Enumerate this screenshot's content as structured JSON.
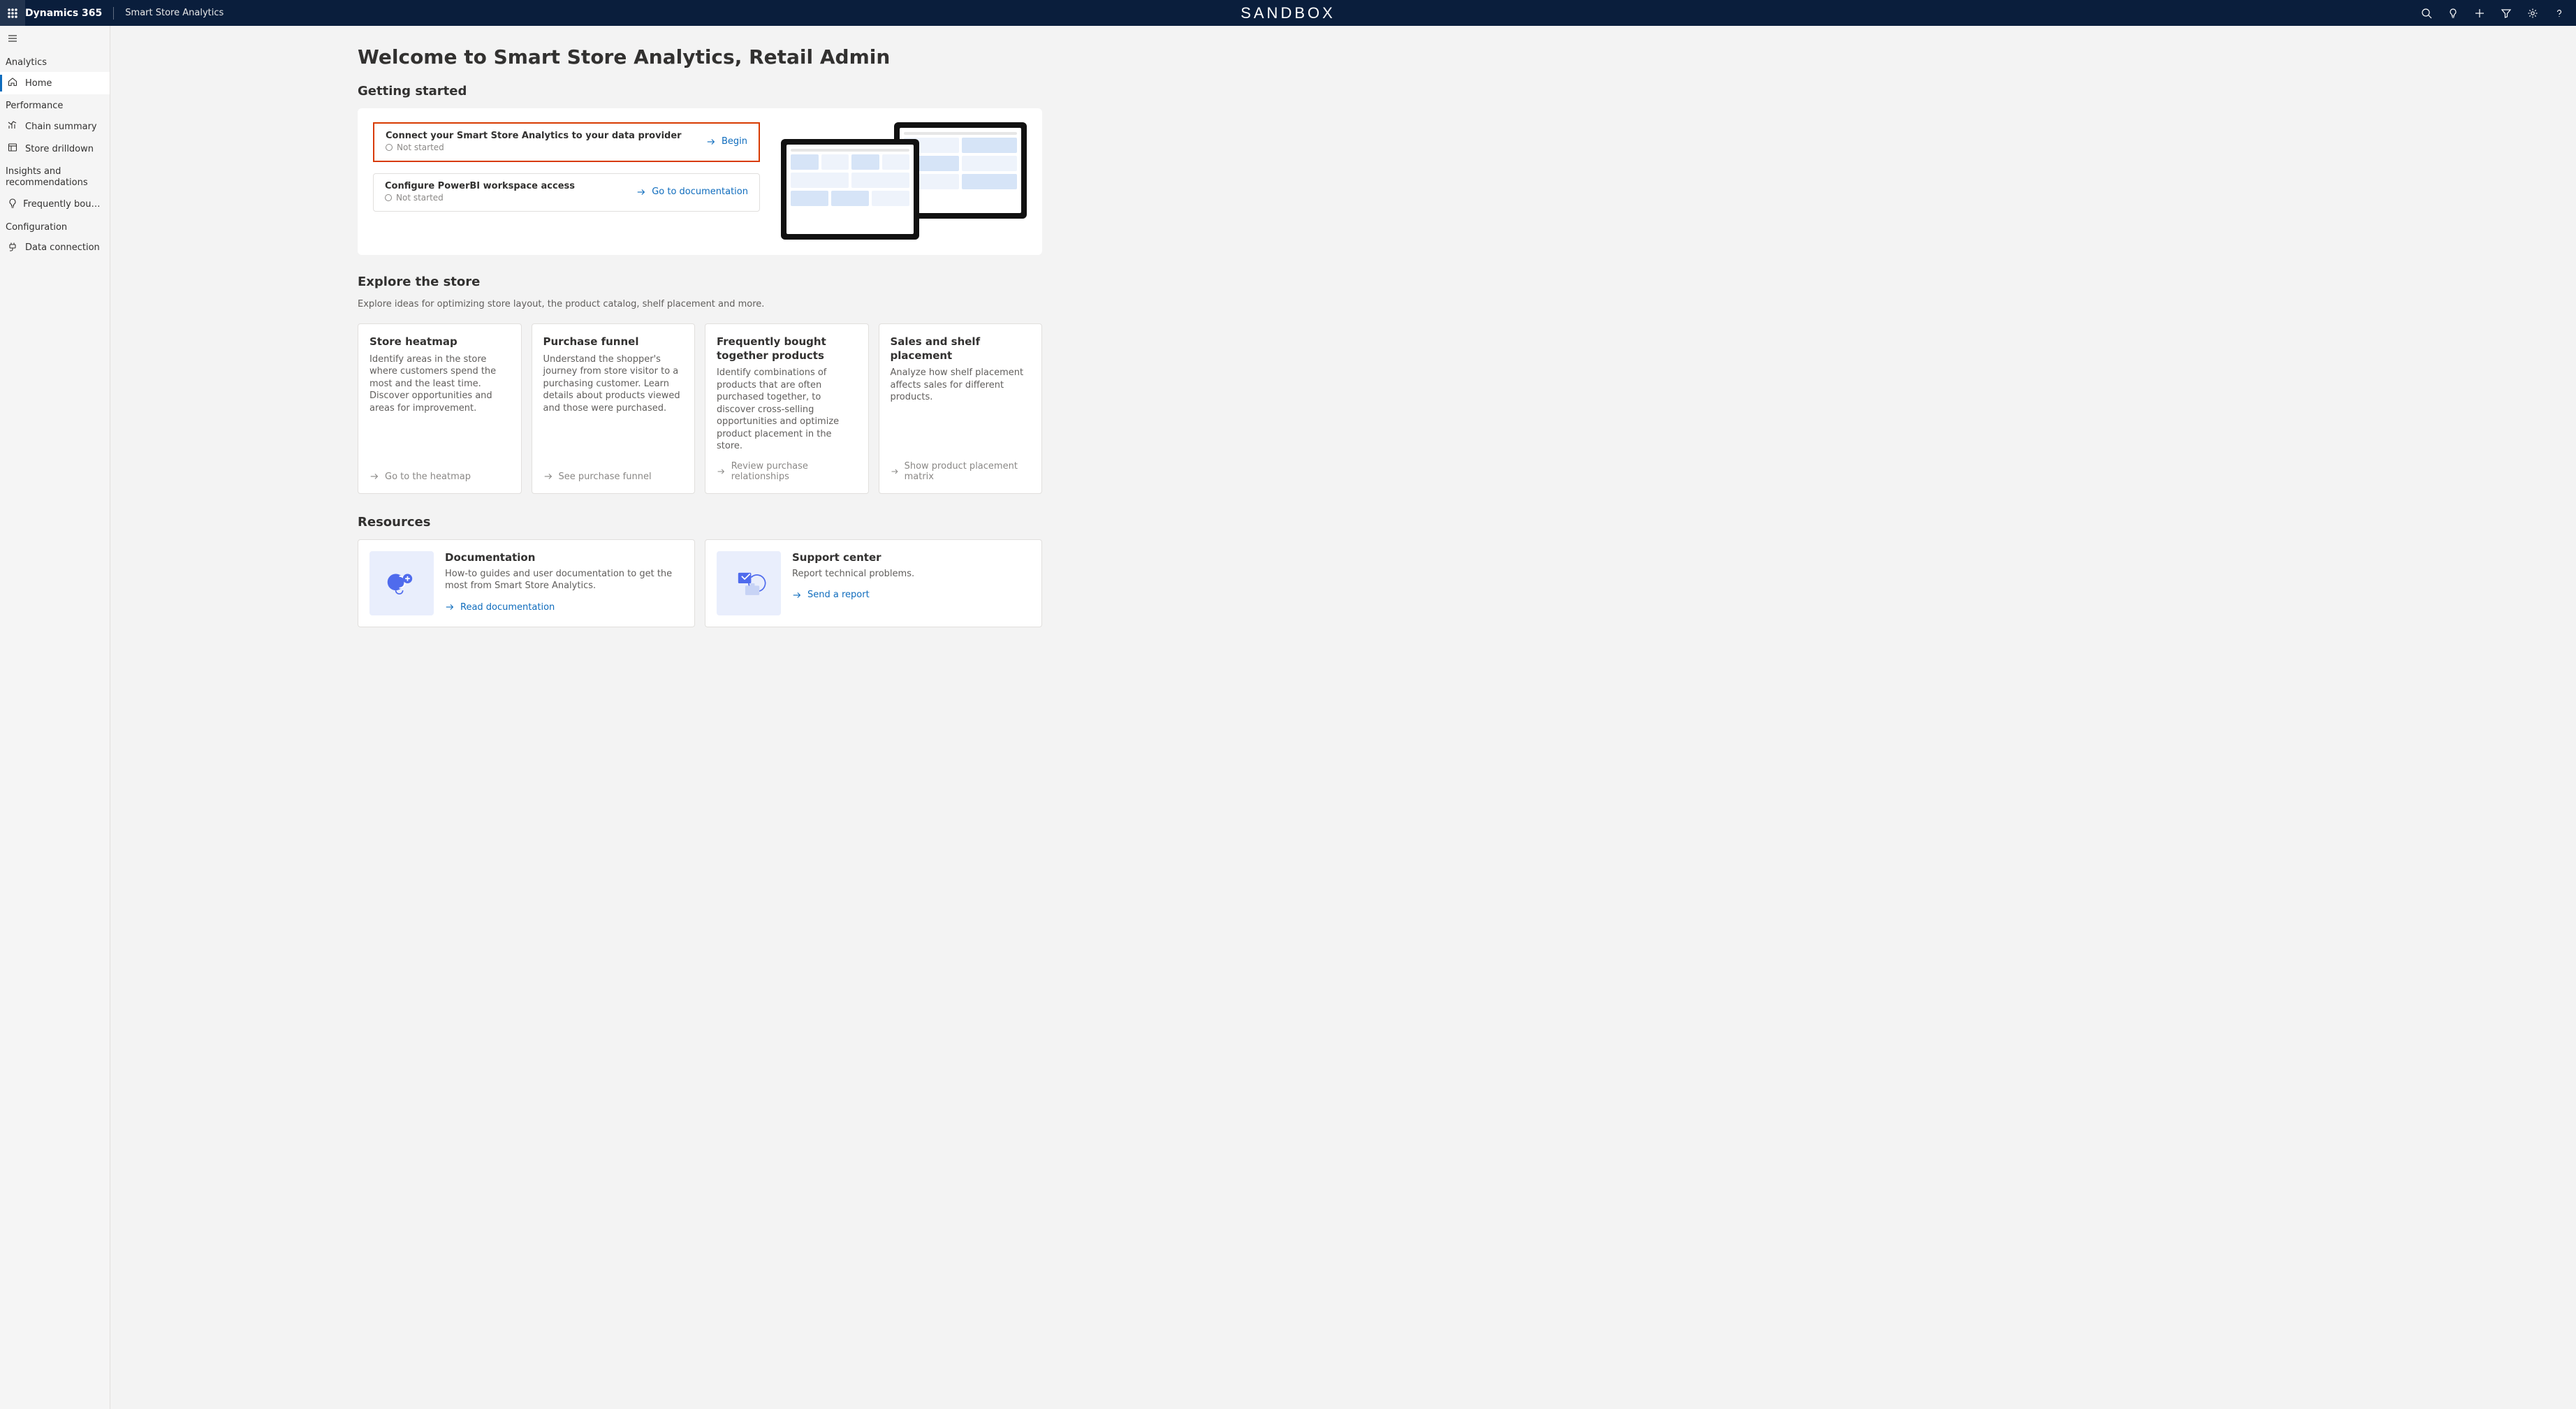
{
  "nav": {
    "brand": "Dynamics 365",
    "app": "Smart Store Analytics",
    "env": "SANDBOX"
  },
  "sidebar": {
    "sections": [
      {
        "label": "Analytics",
        "items": [
          {
            "label": "Home",
            "icon": "home",
            "active": true
          }
        ]
      },
      {
        "label": "Performance",
        "items": [
          {
            "label": "Chain summary",
            "icon": "chart"
          },
          {
            "label": "Store drilldown",
            "icon": "drill"
          }
        ]
      },
      {
        "label": "Insights and recommendations",
        "multiline": true,
        "items": [
          {
            "label": "Frequently bought t…",
            "icon": "bulb"
          }
        ]
      },
      {
        "label": "Configuration",
        "items": [
          {
            "label": "Data connection",
            "icon": "plug"
          }
        ]
      }
    ]
  },
  "page": {
    "title": "Welcome to Smart Store Analytics, Retail Admin",
    "getting_started": {
      "heading": "Getting started",
      "steps": [
        {
          "title": "Connect your Smart Store Analytics to your data provider",
          "status": "Not started",
          "action": "Begin",
          "highlight": true
        },
        {
          "title": "Configure PowerBI workspace access",
          "status": "Not started",
          "action": "Go to documentation",
          "highlight": false
        }
      ]
    },
    "explore": {
      "heading": "Explore the store",
      "sub": "Explore ideas for optimizing store layout, the product catalog, shelf placement and more.",
      "cards": [
        {
          "title": "Store heatmap",
          "desc": "Identify areas in the store where customers spend the most and the least time. Discover opportunities and areas for improvement.",
          "link": "Go to the heatmap"
        },
        {
          "title": "Purchase funnel",
          "desc": "Understand the shopper's journey from store visitor to a purchasing customer. Learn details about products viewed and those were purchased.",
          "link": "See purchase funnel"
        },
        {
          "title": "Frequently bought together products",
          "desc": "Identify combinations of products that are often purchased together, to discover cross-selling opportunities and optimize product placement in the store.",
          "link": "Review purchase relationships"
        },
        {
          "title": "Sales and shelf placement",
          "desc": "Analyze how shelf placement affects sales for different products.",
          "link": "Show product placement matrix"
        }
      ]
    },
    "resources": {
      "heading": "Resources",
      "cards": [
        {
          "title": "Documentation",
          "desc": "How-to guides and user documentation to get the most from Smart Store Analytics.",
          "link": "Read documentation",
          "icon": "doc"
        },
        {
          "title": "Support center",
          "desc": "Report technical problems.",
          "link": "Send a report",
          "icon": "support"
        }
      ]
    }
  }
}
